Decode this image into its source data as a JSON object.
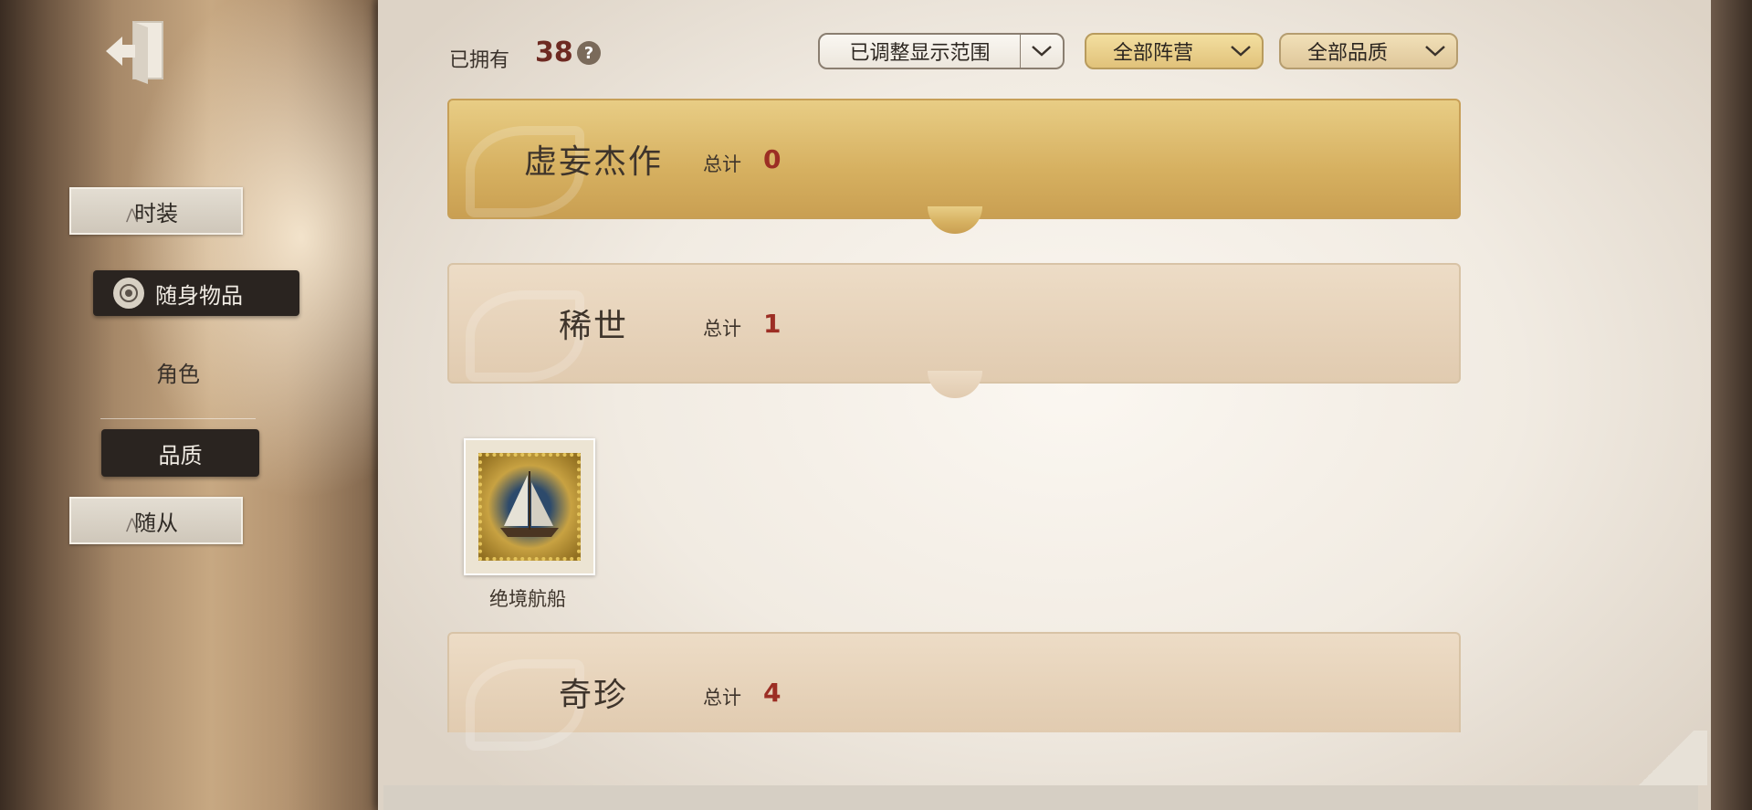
{
  "sidebar": {
    "back_icon": "exit-door-icon",
    "tabs": [
      {
        "label": "时装",
        "state": "collapsed"
      },
      {
        "label": "随身物品",
        "state": "selected"
      },
      {
        "label": "角色",
        "state": "plain"
      },
      {
        "label": "品质",
        "state": "selected-sub"
      },
      {
        "label": "随从",
        "state": "collapsed"
      }
    ]
  },
  "header": {
    "owned_label": "已拥有",
    "owned_count": "38",
    "help_icon": "question-icon",
    "filters": [
      {
        "label": "已调整显示范围"
      },
      {
        "label": "全部阵营"
      },
      {
        "label": "全部品质"
      }
    ]
  },
  "categories": [
    {
      "title": "虚妄杰作",
      "total_label": "总计",
      "total": "0"
    },
    {
      "title": "稀世",
      "total_label": "总计",
      "total": "1"
    },
    {
      "title": "奇珍",
      "total_label": "总计",
      "total": "4"
    }
  ],
  "items": [
    {
      "name": "绝境航船",
      "icon": "sailing-ship-stamp-icon"
    }
  ],
  "colors": {
    "accent_red": "#9c2e24",
    "gold_bar": "#d6b060",
    "beige_bar": "#e1cbb0"
  }
}
